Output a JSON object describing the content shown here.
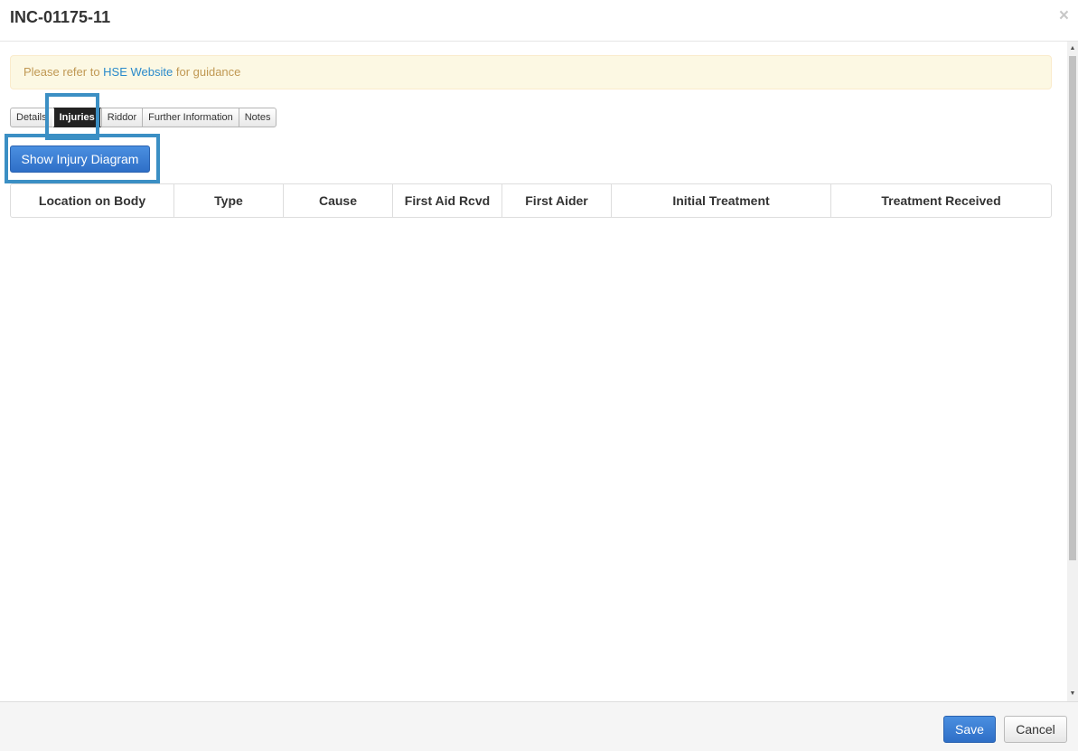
{
  "header": {
    "title": "INC-01175-11",
    "close_glyph": "×"
  },
  "alert": {
    "prefix": "Please refer to ",
    "link_text": "HSE Website",
    "suffix": " for guidance"
  },
  "tabs": [
    {
      "label": "Details",
      "active": false
    },
    {
      "label": "Injuries",
      "active": true
    },
    {
      "label": "Riddor",
      "active": false
    },
    {
      "label": "Further Information",
      "active": false
    },
    {
      "label": "Notes",
      "active": false
    }
  ],
  "actions": {
    "show_diagram_label": "Show Injury Diagram"
  },
  "table": {
    "columns": [
      "Location on Body",
      "Type",
      "Cause",
      "First Aid Rcvd",
      "First Aider",
      "Initial Treatment",
      "Treatment Received"
    ],
    "rows": []
  },
  "scrollbar": {
    "up_glyph": "▲",
    "down_glyph": "▼"
  },
  "footer": {
    "save_label": "Save",
    "cancel_label": "Cancel"
  },
  "colors": {
    "primary": "#3a7fd5",
    "highlight": "#3b8fc4",
    "alert_bg": "#fcf8e3",
    "alert_text": "#c09853",
    "link": "#2a8acb",
    "active_tab": "#222222"
  }
}
